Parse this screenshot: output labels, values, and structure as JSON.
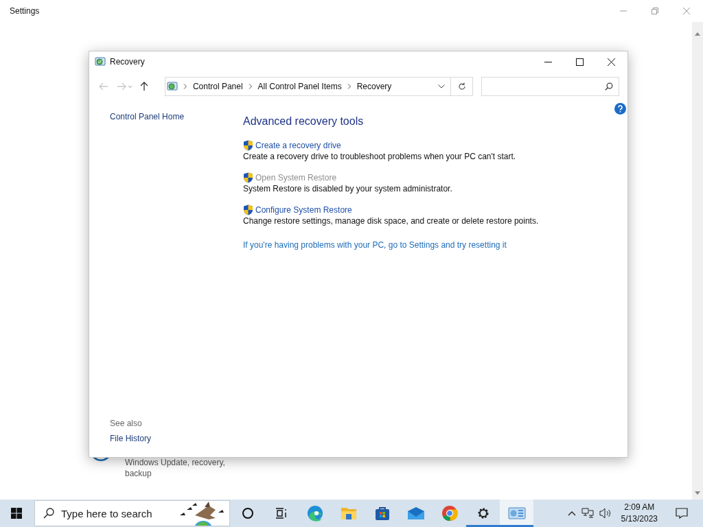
{
  "settings_window": {
    "title": "Settings",
    "item": {
      "description": "Windows Update, recovery, backup"
    }
  },
  "recovery_window": {
    "title": "Recovery",
    "nav": [
      {
        "kind": "back",
        "disabled": true
      },
      {
        "kind": "forward",
        "disabled": true
      },
      {
        "kind": "up",
        "disabled": false
      }
    ],
    "breadcrumb": [
      "Control Panel",
      "All Control Panel Items",
      "Recovery"
    ],
    "sidebar": {
      "items": [
        {
          "label": "Control Panel Home"
        }
      ],
      "see_also_heading": "See also",
      "see_also": [
        {
          "label": "File History"
        }
      ]
    },
    "heading": "Advanced recovery tools",
    "tasks": [
      {
        "link": "Create a recovery drive",
        "description": "Create a recovery drive to troubleshoot problems when your PC can't start.",
        "disabled": false
      },
      {
        "link": "Open System Restore",
        "description": "System Restore is disabled by your system administrator.",
        "disabled": true
      },
      {
        "link": "Configure System Restore",
        "description": "Change restore settings, manage disk space, and create or delete restore points.",
        "disabled": false
      }
    ],
    "reset_link": "If you're having problems with your PC, go to Settings and try resetting it"
  },
  "taskbar": {
    "search_placeholder": "Type here to search",
    "apps": [
      {
        "kind": "cortana",
        "running": false,
        "selected": false
      },
      {
        "kind": "taskview",
        "running": false,
        "selected": false
      },
      {
        "kind": "edge",
        "running": false,
        "selected": false
      },
      {
        "kind": "explorer",
        "running": false,
        "selected": false
      },
      {
        "kind": "store",
        "running": false,
        "selected": false
      },
      {
        "kind": "mail",
        "running": false,
        "selected": false
      },
      {
        "kind": "chrome",
        "running": false,
        "selected": false
      },
      {
        "kind": "settings",
        "running": true,
        "selected": false
      },
      {
        "kind": "controlpanel",
        "running": true,
        "selected": true
      }
    ],
    "time": "2:09 AM",
    "date": "5/13/2023"
  }
}
